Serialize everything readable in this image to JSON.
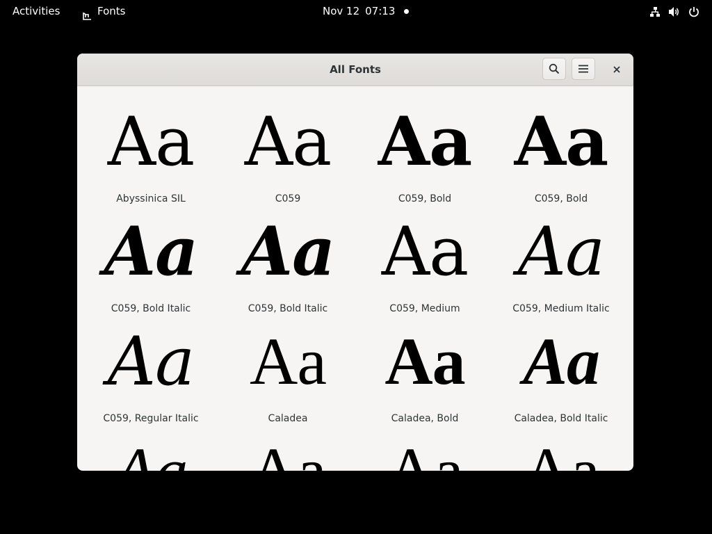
{
  "topbar": {
    "activities_label": "Activities",
    "app_name": "Fonts",
    "clock_date": "Nov 12",
    "clock_time": "07:13",
    "tray_icons": [
      "network-icon",
      "volume-icon",
      "power-icon"
    ]
  },
  "window": {
    "title": "All Fonts",
    "buttons": [
      "search-icon",
      "hamburger-menu-icon",
      "close-icon"
    ]
  },
  "fonts": [
    {
      "sample": "Aa",
      "name": "Abyssinica SIL"
    },
    {
      "sample": "Aa",
      "name": "C059"
    },
    {
      "sample": "Aa",
      "name": "C059, Bold"
    },
    {
      "sample": "Aa",
      "name": "C059, Bold"
    },
    {
      "sample": "Aa",
      "name": "C059, Bold Italic"
    },
    {
      "sample": "Aa",
      "name": "C059, Bold Italic"
    },
    {
      "sample": "Aa",
      "name": "C059, Medium"
    },
    {
      "sample": "Aa",
      "name": "C059, Medium Italic"
    },
    {
      "sample": "Aa",
      "name": "C059, Regular Italic"
    },
    {
      "sample": "Aa",
      "name": "Caladea"
    },
    {
      "sample": "Aa",
      "name": "Caladea, Bold"
    },
    {
      "sample": "Aa",
      "name": "Caladea, Bold Italic"
    },
    {
      "sample": "Aa"
    },
    {
      "sample": "Aa"
    },
    {
      "sample": "Aa"
    },
    {
      "sample": "Aa"
    }
  ],
  "colors": {
    "desktop_background": "#000000",
    "window_background": "#f6f5f4",
    "headerbar": "#e1dedb",
    "text": "#2e3436"
  }
}
